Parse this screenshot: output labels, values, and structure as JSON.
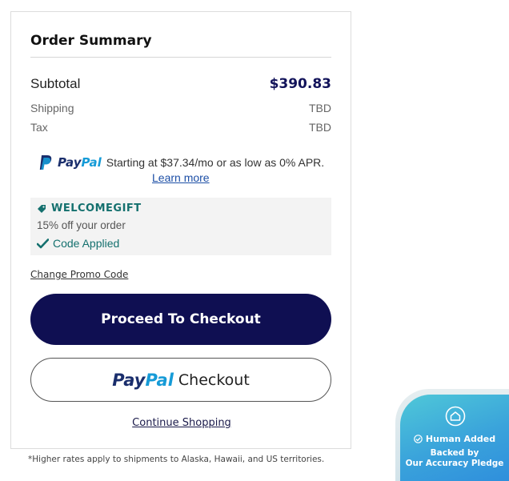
{
  "summary": {
    "title": "Order Summary",
    "subtotal_label": "Subtotal",
    "subtotal_value": "$390.83",
    "shipping_label": "Shipping",
    "shipping_value": "TBD",
    "tax_label": "Tax",
    "tax_value": "TBD"
  },
  "paypal_promo": {
    "logo_pay": "Pay",
    "logo_pal": "Pal",
    "text": "Starting at $37.34/mo or as low as 0% APR.",
    "learn_more": "Learn more"
  },
  "coupon": {
    "code": "WELCOMEGIFT",
    "description": "15% off your order",
    "status": "Code Applied",
    "icon": "tag-icon",
    "status_icon": "checkmark-icon"
  },
  "actions": {
    "change_promo": "Change Promo Code",
    "checkout": "Proceed To Checkout",
    "paypal_pay": "Pay",
    "paypal_pal": "Pal",
    "paypal_checkout": "Checkout",
    "continue": "Continue Shopping"
  },
  "footnote": "*Higher rates apply to shipments to Alaska, Hawaii, and US territories.",
  "pledge": {
    "title": "Human Added",
    "line1": "Backed by",
    "line2": "Our Accuracy Pledge",
    "icon": "house-icon"
  },
  "colors": {
    "brand_navy": "#0f0f52",
    "teal": "#14706e",
    "paypal_dark": "#1a2e6c",
    "paypal_light": "#169bd7"
  }
}
